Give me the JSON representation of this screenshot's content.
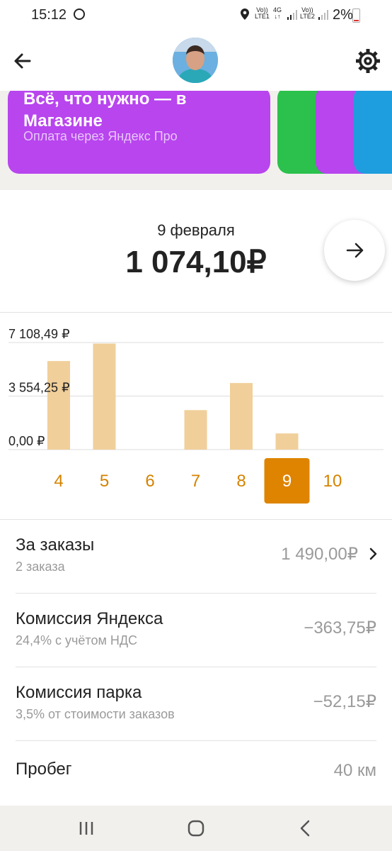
{
  "status_bar": {
    "time": "15:12",
    "sim1_top": "Vo))",
    "sim1_bottom": "LTE1",
    "network": "4G",
    "sim2_top": "Vo))",
    "sim2_bottom": "LTE2",
    "battery": "2%",
    "icons": [
      "sync-icon",
      "location-icon",
      "signal-icon",
      "battery-icon"
    ]
  },
  "header": {
    "icons": [
      "back-arrow-icon",
      "avatar",
      "settings-gear-icon"
    ]
  },
  "promo": {
    "title": "Всё, что нужно — в Магазине",
    "subtitle": "Оплата через Яндекс Про",
    "colors": {
      "main": "#b845ee",
      "green": "#2bc14c",
      "purple": "#b845ee",
      "blue": "#1e9ede"
    }
  },
  "summary": {
    "date": "9 февраля",
    "amount": "1 074,10₽",
    "next_icon": "arrow-right-icon"
  },
  "chart_data": {
    "type": "bar",
    "categories": [
      "4",
      "5",
      "6",
      "7",
      "8",
      "9",
      "10"
    ],
    "values": [
      5880,
      7040,
      0,
      2620,
      4420,
      1074.1,
      0
    ],
    "y_tick_labels": [
      "7 108,49 ₽",
      "3 554,25 ₽",
      "0,00 ₽"
    ],
    "y_ticks": [
      7108.49,
      3554.25,
      0
    ],
    "ylim": [
      0,
      7108.49
    ],
    "selected_index": 5,
    "bar_color": "#f0cf9a",
    "selected_color": "#de8400",
    "label_color": "#d48300"
  },
  "details": [
    {
      "title": "За заказы",
      "subtitle": "2 заказа",
      "value": "1 490,00₽",
      "has_chevron": true
    },
    {
      "title": "Комиссия Яндекса",
      "subtitle": "24,4% с учётом НДС",
      "value": "−363,75₽",
      "has_chevron": false
    },
    {
      "title": "Комиссия парка",
      "subtitle": "3,5% от стоимости заказов",
      "value": "−52,15₽",
      "has_chevron": false
    },
    {
      "title": "Пробег",
      "subtitle": "",
      "value": "40 км",
      "has_chevron": false
    }
  ],
  "nav_bar": {
    "icons": [
      "recent-apps-icon",
      "home-icon",
      "back-icon"
    ]
  }
}
